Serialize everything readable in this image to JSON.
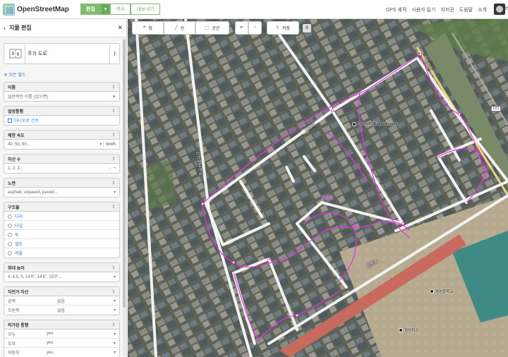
{
  "header": {
    "app_name": "OpenStreetMap",
    "modes": {
      "edit": "편집",
      "edit_caret": "▾",
      "history": "역사",
      "export": "내보내기"
    },
    "nav": [
      "GPS 궤적",
      "사용자 일기",
      "지저귄",
      "도움말",
      "소개"
    ],
    "user": "th"
  },
  "sidebar": {
    "title": "지물 편집",
    "back_icon": "chevron-left-icon",
    "close_icon": "close-icon",
    "preset": {
      "name": "주거 도로",
      "icon": "road-icon",
      "more": "⋮"
    },
    "all_fields": "▼ 모든 필드",
    "fields": {
      "name": {
        "label": "이름",
        "placeholder": "일반적인 이름 (있으면)",
        "add": "+"
      },
      "oneway": {
        "label": "일방통행",
        "value": "아니오로 간주"
      },
      "maxspeed": {
        "label": "제한 속도",
        "placeholder": "40, 50, 60...",
        "unit": "km/h"
      },
      "lanes": {
        "label": "차선 수",
        "placeholder": "1, 2, 3..."
      },
      "surface": {
        "label": "노면",
        "placeholder": "asphalt, unpaved, paved..."
      },
      "structure": {
        "label": "구조물",
        "options": [
          "다리",
          "터널",
          "둑",
          "절토",
          "여울"
        ]
      },
      "maxheight": {
        "label": "최대 높이",
        "placeholder": "4, 4.5, 5, 14'0\", 14'6\", 15'0\"..."
      },
      "cycleway": {
        "label": "자전거 차선",
        "rows": [
          {
            "k": "왼쪽",
            "v": "없음"
          },
          {
            "k": "오른쪽",
            "v": "없음"
          }
        ]
      },
      "access": {
        "label": "허가된 통행",
        "rows": [
          {
            "k": "모두",
            "v": "yes"
          },
          {
            "k": "도보",
            "v": "yes"
          },
          {
            "k": "자동차",
            "v": "yes"
          }
        ]
      }
    },
    "menu_icon": "⋮",
    "dropdown_icon": "▾"
  },
  "toolbar": {
    "point": "점",
    "line": "선",
    "area": "공간",
    "undo_icon": "undo-icon",
    "redo_icon": "redo-icon",
    "save": "저장",
    "count": "8"
  },
  "map": {
    "labels": [
      "인천로",
      "인천로64번길",
      "인천로",
      "인천로",
      "인천로"
    ],
    "pois": [
      "GentlyBnB guesthouse",
      "경성중학교",
      "경성피크"
    ],
    "shield": "101",
    "colors": {
      "highlight": "#e831e8",
      "road": "#f2f2f2",
      "rail": "#e9d76b"
    }
  }
}
